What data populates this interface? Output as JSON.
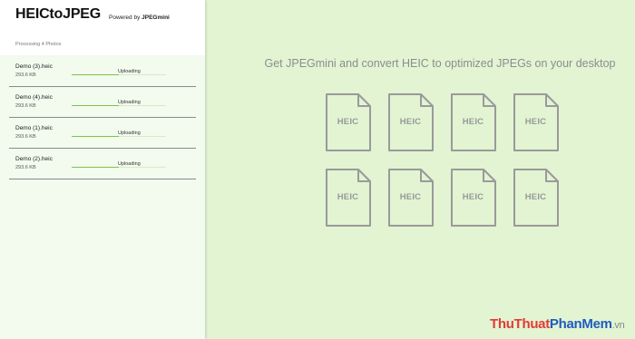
{
  "header": {
    "app_title": "HEICtoJPEG",
    "powered_prefix": "Powered by",
    "powered_brand": "JPEGmini",
    "processing": "Processing 4 Photos"
  },
  "files": [
    {
      "name": "Demo (3).heic",
      "size": "293.6 KB",
      "status": "Uploading",
      "progress": 0.5
    },
    {
      "name": "Demo (4).heic",
      "size": "293.6 KB",
      "status": "Uploading",
      "progress": 0.5
    },
    {
      "name": "Demo (1).heic",
      "size": "293.6 KB",
      "status": "Uploading",
      "progress": 0.5
    },
    {
      "name": "Demo (2).heic",
      "size": "293.6 KB",
      "status": "Uploading",
      "progress": 0.5
    }
  ],
  "main": {
    "heading": "Get JPEGmini and convert HEIC to optimized JPEGs on your desktop",
    "icon_label": "HEIC",
    "icon_count": 8
  },
  "watermark": {
    "part1": "ThuThuat",
    "part2": "PhanMem",
    "part3": ".vn"
  },
  "colors": {
    "sidebar_bg": "#f3faee",
    "page_bg": "#e2f4d2",
    "progress": "#7ec34b"
  }
}
